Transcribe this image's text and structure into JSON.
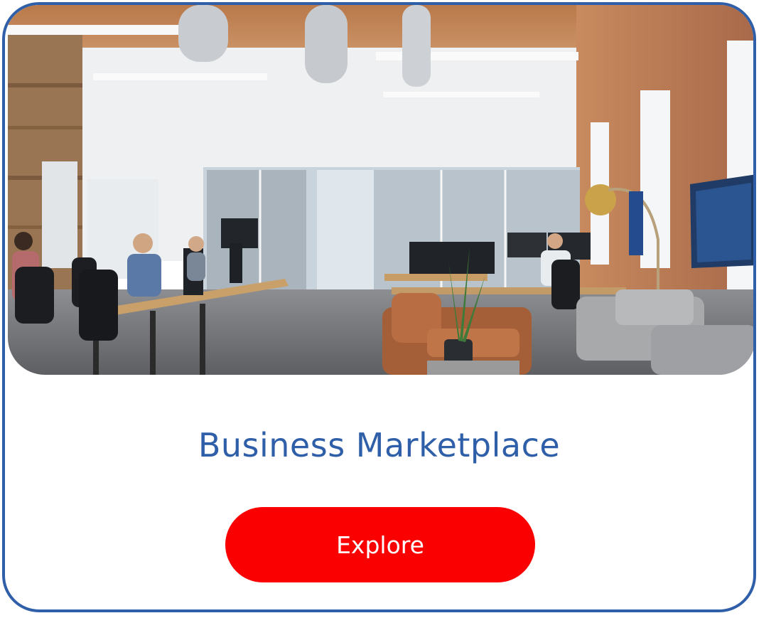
{
  "card": {
    "title": "Business Marketplace",
    "button_label": "Explore",
    "image_alt": "open-plan office with desks, monitors and lounge chairs"
  },
  "colors": {
    "border": "#2f5fa8",
    "title": "#2f5fa8",
    "button": "#fa0000",
    "button_text": "#ffffff"
  }
}
